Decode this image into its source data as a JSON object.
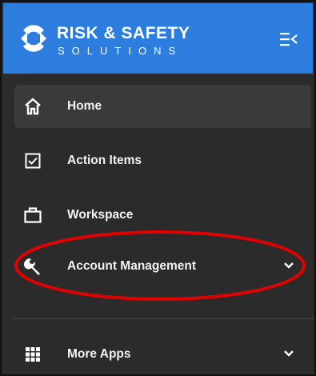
{
  "brand": {
    "line1": "RISK & SAFETY",
    "line2": "SOLUTIONS",
    "accent_color": "#2d7ddf"
  },
  "header": {
    "toggle_icon": "collapse-menu-icon"
  },
  "sidebar": {
    "items": [
      {
        "label": "Home",
        "icon": "home-icon",
        "active": true
      },
      {
        "label": "Action Items",
        "icon": "checkbox-icon",
        "active": false
      },
      {
        "label": "Workspace",
        "icon": "briefcase-icon",
        "active": false
      },
      {
        "label": "Account Management",
        "icon": "wrench-icon",
        "active": false,
        "expandable": true
      },
      {
        "label": "More Apps",
        "icon": "grid-icon",
        "active": false,
        "expandable": true
      }
    ]
  },
  "annotation": {
    "highlight_color": "#e00000"
  }
}
